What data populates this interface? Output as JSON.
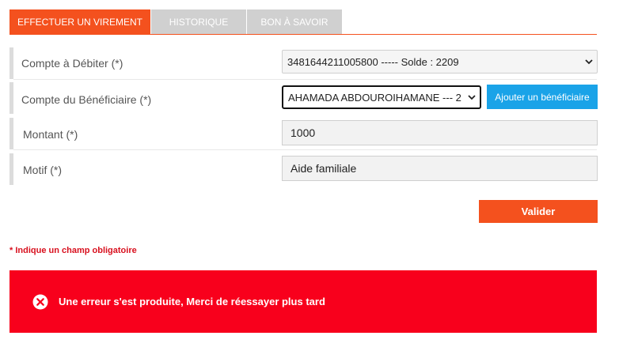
{
  "tabs": {
    "virement": "EFFECTUER UN VIREMENT",
    "historique": "HISTORIQUE",
    "bon_a_savoir": "BON À SAVOIR"
  },
  "form": {
    "compte_debiter": {
      "label": "Compte à Débiter (*)",
      "value": "3481644211005800 ----- Solde : 2209"
    },
    "compte_beneficiaire": {
      "label": "Compte du Bénéficiaire (*)",
      "value": "AHAMADA ABDOUROIHAMANE --- 2"
    },
    "montant": {
      "label": "Montant (*)",
      "value": "1000"
    },
    "motif": {
      "label": "Motif (*)",
      "value": "Aide familiale"
    }
  },
  "buttons": {
    "ajouter_beneficiaire": "Ajouter un bénéficiaire",
    "valider": "Valider"
  },
  "required_note": "* Indique un champ obligatoire",
  "error": {
    "message": "Une erreur s'est produite, Merci de réessayer plus tard",
    "icon": "close-circle-icon"
  },
  "colors": {
    "accent": "#f4511e",
    "info_button": "#1aa3e8",
    "error_background": "#f8001c",
    "required_text": "#d8101e"
  }
}
